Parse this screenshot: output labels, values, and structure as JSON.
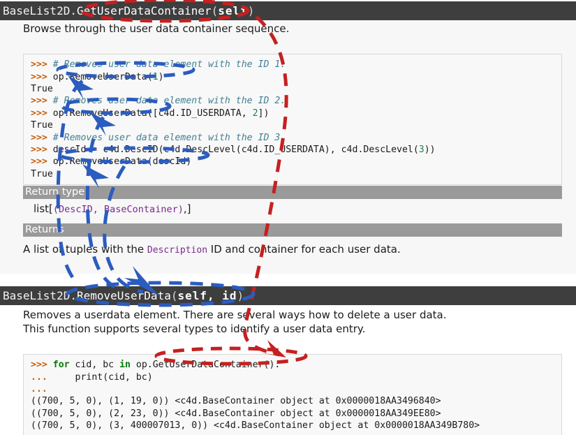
{
  "sections": [
    {
      "signature": {
        "class_name": "BaseList2D",
        "separator": ".",
        "function_name": "GetUserDataContainer",
        "open_paren": "(",
        "params": "self",
        "close_paren": ")"
      },
      "description": "Browse through the user data container sequence.",
      "code": [
        {
          "prompt": ">>> ",
          "parts": [
            {
              "t": "comment",
              "s": "# Removes user data element with the ID 1."
            }
          ]
        },
        {
          "prompt": ">>> ",
          "parts": [
            {
              "t": "plain",
              "s": "op.RemoveUserData("
            },
            {
              "t": "number",
              "s": "1"
            },
            {
              "t": "plain",
              "s": ")"
            }
          ]
        },
        {
          "prompt": "",
          "parts": [
            {
              "t": "out",
              "s": "True"
            }
          ]
        },
        {
          "prompt": ">>> ",
          "parts": [
            {
              "t": "comment",
              "s": "# Removes user data element with the ID 2."
            }
          ]
        },
        {
          "prompt": ">>> ",
          "parts": [
            {
              "t": "plain",
              "s": "op.RemoveUserData([c4d.ID_USERDATA, "
            },
            {
              "t": "number",
              "s": "2"
            },
            {
              "t": "plain",
              "s": "])"
            }
          ]
        },
        {
          "prompt": "",
          "parts": [
            {
              "t": "out",
              "s": "True"
            }
          ]
        },
        {
          "prompt": ">>> ",
          "parts": [
            {
              "t": "comment",
              "s": "# Removes user data element with the ID 3."
            }
          ]
        },
        {
          "prompt": ">>> ",
          "parts": [
            {
              "t": "plain",
              "s": "descId = c4d.DescID(c4d.DescLevel(c4d.ID_USERDATA), c4d.DescLevel("
            },
            {
              "t": "number",
              "s": "3"
            },
            {
              "t": "plain",
              "s": "))"
            }
          ]
        },
        {
          "prompt": ">>> ",
          "parts": [
            {
              "t": "plain",
              "s": "op.RemoveUserData(descId)"
            }
          ]
        },
        {
          "prompt": "",
          "parts": [
            {
              "t": "out",
              "s": "True"
            }
          ]
        }
      ],
      "rubrics": [
        {
          "title": "Return type",
          "value_parts": [
            {
              "t": "plain",
              "s": "list["
            },
            {
              "t": "mono",
              "s": "(DescID, BaseContainer)"
            },
            {
              "t": "plain",
              "s": ",]"
            }
          ]
        },
        {
          "title": "Returns",
          "text_before": "A list of tuples with the ",
          "inline_code": "Description",
          "text_after": " ID and container for each user data."
        }
      ]
    },
    {
      "signature": {
        "class_name": "BaseList2D",
        "separator": ".",
        "function_name": "RemoveUserData",
        "open_paren": "(",
        "params": "self, id",
        "close_paren": ")"
      },
      "description_line_1": "Removes a userdata element. There are several ways how to delete a user data.",
      "description_line_2": "This function supports several types to identify a user data entry.",
      "code": [
        {
          "prompt": ">>> ",
          "parts": [
            {
              "t": "kw",
              "s": "for"
            },
            {
              "t": "plain",
              "s": " cid, bc "
            },
            {
              "t": "kw",
              "s": "in"
            },
            {
              "t": "plain",
              "s": " op.GetUserDataContainer():"
            }
          ]
        },
        {
          "prompt": "... ",
          "parts": [
            {
              "t": "plain",
              "s": "    print(cid, bc)"
            }
          ]
        },
        {
          "prompt": "... ",
          "parts": [
            {
              "t": "plain",
              "s": ""
            }
          ]
        },
        {
          "prompt": "",
          "parts": [
            {
              "t": "out",
              "s": "((700, 5, 0), (1, 19, 0)) <c4d.BaseContainer object at 0x0000018AA3496840>"
            }
          ]
        },
        {
          "prompt": "",
          "parts": [
            {
              "t": "out",
              "s": "((700, 5, 0), (2, 23, 0)) <c4d.BaseContainer object at 0x0000018AA349EE80>"
            }
          ]
        },
        {
          "prompt": "",
          "parts": [
            {
              "t": "out",
              "s": "((700, 5, 0), (3, 400007013, 0)) <c4d.BaseContainer object at 0x0000018AA349B780>"
            }
          ]
        }
      ]
    }
  ],
  "annotations": {
    "red": {
      "color": "#c62020",
      "note": "dashed oval around GetUserDataContainer(self) in top signature, curved dashed arrow down to GetUserDataContainer() in bottom code block, dashed oval around that call"
    },
    "blue": {
      "color": "#2b5cbf",
      "note": "dashed ovals around three op.RemoveUserData(...) calls in top code block, three arrows to RemoveUserData(self, id) signature and dashed oval around it"
    }
  }
}
